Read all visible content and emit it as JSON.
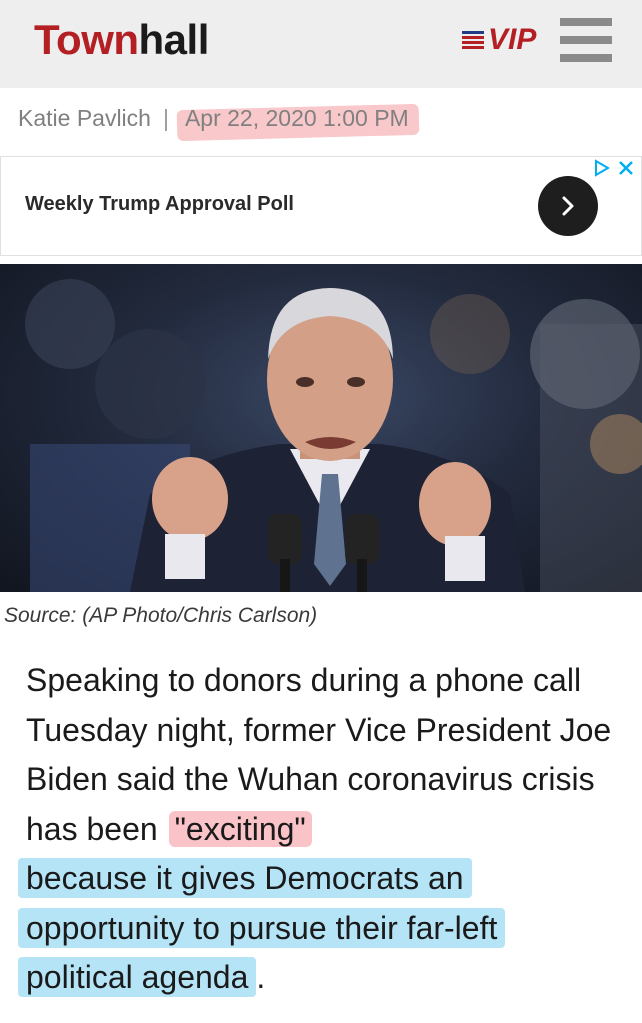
{
  "header": {
    "logo_part1": "Town",
    "logo_part2": "hall",
    "vip_label": "VIP",
    "menu_icon": "hamburger-menu-icon",
    "brand_red": "#b41f24"
  },
  "byline": {
    "author": "Katie Pavlich",
    "separator": "|",
    "date": "Apr 22, 2020 1:00 PM"
  },
  "ad": {
    "title": "Weekly Trump Approval Poll",
    "arrow_icon": "chevron-right-icon",
    "adchoices_icon": "adchoices-icon",
    "close_icon": "close-icon"
  },
  "photo": {
    "caption": "Source: (AP Photo/Chris Carlson)"
  },
  "article": {
    "plain": "Speaking to donors during a phone call Tuesday night, former Vice President Joe Biden said the Wuhan coronavirus crisis has been ",
    "quote": "\"exciting\"",
    "highlight_1": "because it gives Democrats an",
    "highlight_2": "opportunity to pursue their far-left",
    "highlight_3": "political agenda",
    "tail": "."
  }
}
